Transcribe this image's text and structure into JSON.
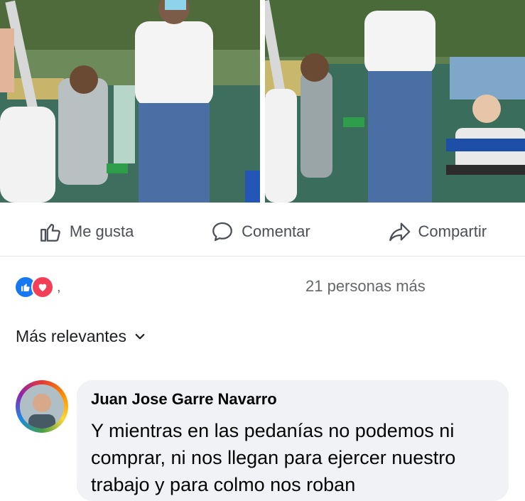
{
  "post": {
    "photos": [
      {
        "name": "photo-left"
      },
      {
        "name": "photo-right"
      }
    ]
  },
  "actions": {
    "like_label": "Me gusta",
    "comment_label": "Comentar",
    "share_label": "Compartir"
  },
  "reactions": {
    "icons": [
      "like-reaction-icon",
      "love-reaction-icon"
    ],
    "separator": ",",
    "summary": "21 personas más"
  },
  "comments_filter": {
    "label": "Más relevantes"
  },
  "comment": {
    "author": "Juan Jose Garre Navarro",
    "text": "Y mientras en las pedanías no podemos ni comprar, ni nos llegan para ejercer nuestro trabajo y para colmo nos roban"
  },
  "colors": {
    "like_blue": "#1877f2",
    "love_red": "#f33e58",
    "action_grey": "#4b4f56",
    "bubble_bg": "#f0f2f5"
  }
}
